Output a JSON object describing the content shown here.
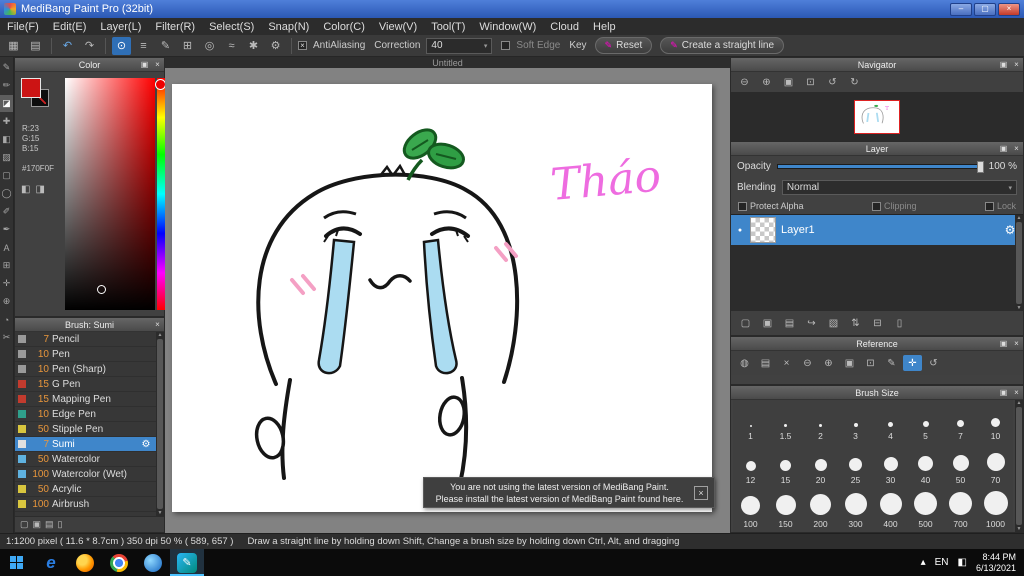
{
  "window": {
    "title": "MediBang Paint Pro (32bit)"
  },
  "menu": {
    "items": [
      "File(F)",
      "Edit(E)",
      "Layer(L)",
      "Filter(R)",
      "Select(S)",
      "Snap(N)",
      "Color(C)",
      "View(V)",
      "Tool(T)",
      "Window(W)",
      "Cloud",
      "Help"
    ]
  },
  "toolbar": {
    "antialiasing": "AntiAliasing",
    "correction": "Correction",
    "correction_value": "40",
    "soft_edge": "Soft Edge",
    "key": "Key",
    "reset": "Reset",
    "straight_line": "Create a straight line"
  },
  "color_panel": {
    "title": "Color",
    "r": "R:23",
    "g": "G:15",
    "b": "B:15",
    "hex": "#170F0F",
    "fg_color": "#cc1414"
  },
  "brush_panel": {
    "title": "Brush: Sumi",
    "brushes": [
      {
        "size": "7",
        "name": "Pencil",
        "tag": "#9a9a9a"
      },
      {
        "size": "10",
        "name": "Pen",
        "tag": "#9a9a9a"
      },
      {
        "size": "10",
        "name": "Pen (Sharp)",
        "tag": "#9a9a9a"
      },
      {
        "size": "15",
        "name": "G Pen",
        "tag": "#c23b2e"
      },
      {
        "size": "15",
        "name": "Mapping Pen",
        "tag": "#c23b2e"
      },
      {
        "size": "10",
        "name": "Edge Pen",
        "tag": "#2fa08c"
      },
      {
        "size": "50",
        "name": "Stipple Pen",
        "tag": "#d8c53e"
      },
      {
        "size": "7",
        "name": "Sumi",
        "tag": "#e0e0e0"
      },
      {
        "size": "50",
        "name": "Watercolor",
        "tag": "#5fb2e0"
      },
      {
        "size": "100",
        "name": "Watercolor (Wet)",
        "tag": "#5fb2e0"
      },
      {
        "size": "50",
        "name": "Acrylic",
        "tag": "#d8c53e"
      },
      {
        "size": "100",
        "name": "Airbrush",
        "tag": "#d8c53e"
      }
    ]
  },
  "canvas": {
    "tab_title": "Untitled",
    "signature": "Tháo",
    "signature_color": "#ee6ce0",
    "notification_line1": "You are not using the latest version of MediBang Paint.",
    "notification_line2": "Please install the latest version of MediBang Paint found here."
  },
  "navigator": {
    "title": "Navigator"
  },
  "layer_panel": {
    "title": "Layer",
    "opacity_label": "Opacity",
    "opacity_value": "100 %",
    "blending_label": "Blending",
    "blending_value": "Normal",
    "protect_alpha": "Protect Alpha",
    "clipping": "Clipping",
    "lock": "Lock",
    "layer1": "Layer1"
  },
  "reference_panel": {
    "title": "Reference"
  },
  "brush_size_panel": {
    "title": "Brush Size",
    "sizes": [
      "1",
      "1.5",
      "2",
      "3",
      "4",
      "5",
      "7",
      "10",
      "12",
      "15",
      "20",
      "25",
      "30",
      "40",
      "50",
      "70",
      "100",
      "150",
      "200",
      "300",
      "400",
      "500",
      "700",
      "1000"
    ]
  },
  "statusbar": {
    "info": "1:1200 pixel   ( 11.6 * 8.7cm )   350 dpi   50 %   ( 589, 657 )",
    "hint": "Draw a straight line by holding down Shift, Change a brush size by holding down Ctrl, Alt, and dragging"
  },
  "taskbar": {
    "language": "EN",
    "time": "8:44 PM",
    "date": "6/13/2021"
  },
  "icons": {
    "min": "–",
    "max": "▢",
    "close": "×",
    "popout": "▣",
    "dropdown": "▾",
    "check": "×",
    "undo": "↶",
    "redo": "↷",
    "gear": "⚙",
    "eye": "●",
    "pen": "✎",
    "scroll_up": "▲",
    "scroll_down": "▼",
    "tray_up": "▴",
    "tray_box": "◧",
    "tb": [
      "▦",
      "▤"
    ],
    "draw": [
      "⊙",
      "≡",
      "✎",
      "⊞",
      "◎",
      "≈",
      "✱",
      "⚙"
    ],
    "left": [
      "✎",
      "✏",
      "◪",
      "✚",
      "◧",
      "▨",
      "▢",
      "◯",
      "✐",
      "✒",
      "A",
      "⊞",
      "✛",
      "⊕",
      "◔",
      "✂"
    ],
    "nav": [
      "⊖",
      "⊕",
      "▣",
      "⊡",
      "↺",
      "↻"
    ],
    "ref": [
      "◍",
      "▤",
      "×",
      "⊖",
      "⊕",
      "▣",
      "⊡",
      "✎",
      "✛",
      "↺"
    ],
    "layer": [
      "▢",
      "▣",
      "▤",
      "↪",
      "▧",
      "⇅",
      "⊟",
      "▯"
    ],
    "bfoot": [
      "▢",
      "▣",
      "▤",
      "▯"
    ]
  }
}
